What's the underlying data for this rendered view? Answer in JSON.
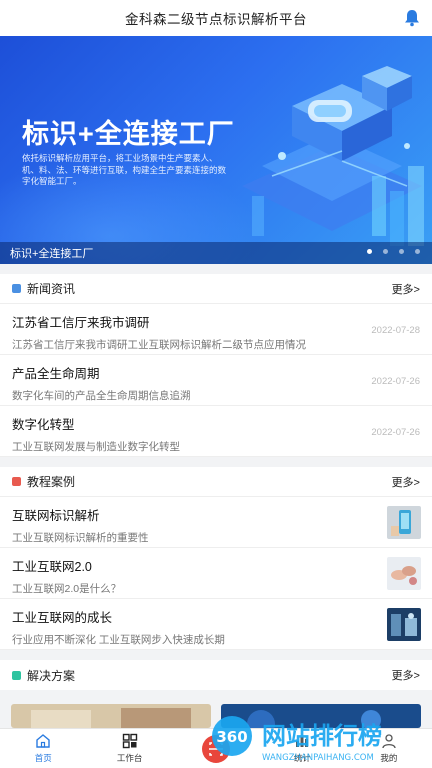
{
  "header": {
    "title": "金科森二级节点标识解析平台",
    "icon": "bell-icon"
  },
  "banner": {
    "headline": "标识+全连接工厂",
    "description": "依托标识解析应用平台，将工业场景中生产要素人、机、料、法、环等进行互联，构建全生产要素连接的数字化智能工厂。",
    "caption": "标识+全连接工厂",
    "slide_count": 4,
    "active_slide": 1
  },
  "news": {
    "title": "新闻资讯",
    "more": "更多>",
    "icon_color": "#4a90e2",
    "items": [
      {
        "title": "江苏省工信厅来我市调研",
        "subtitle": "江苏省工信厅来我市调研工业互联网标识解析二级节点应用情况",
        "date": "2022-07-28"
      },
      {
        "title": "产品全生命周期",
        "subtitle": "数字化车间的产品全生命周期信息追溯",
        "date": "2022-07-26"
      },
      {
        "title": "数字化转型",
        "subtitle": "工业互联网发展与制造业数字化转型",
        "date": "2022-07-26"
      }
    ]
  },
  "cases": {
    "title": "教程案例",
    "more": "更多>",
    "icon_color": "#e85a4f",
    "items": [
      {
        "title": "互联网标识解析",
        "subtitle": "工业互联网标识解析的重要性"
      },
      {
        "title": "工业互联网2.0",
        "subtitle": "工业互联网2.0是什么？"
      },
      {
        "title": "工业互联网的成长",
        "subtitle": "行业应用不断深化 工业互联网步入快速成长期"
      }
    ]
  },
  "solutions": {
    "title": "解决方案",
    "more": "更多>",
    "icon_color": "#2ec4a0"
  },
  "tabbar": {
    "tabs": [
      {
        "label": "首页",
        "icon": "home-icon",
        "active": true
      },
      {
        "label": "工作台",
        "icon": "grid-icon",
        "active": false
      },
      {
        "label": "",
        "icon": "scan-icon",
        "active": false
      },
      {
        "label": "统计",
        "icon": "chart-icon",
        "active": false
      },
      {
        "label": "我的",
        "icon": "user-icon",
        "active": false
      }
    ]
  },
  "watermark": {
    "brand": "360",
    "text": "网站排行榜",
    "url": "WANGZHANPAIHANG.COM"
  },
  "colors": {
    "accent": "#2a7be0",
    "banner_start": "#1d4fd8",
    "banner_end": "#3aa0f5"
  }
}
